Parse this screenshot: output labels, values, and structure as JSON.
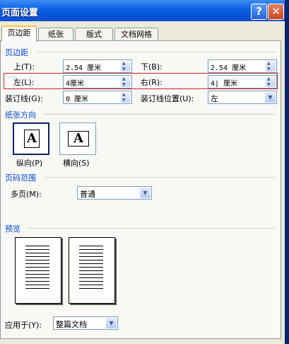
{
  "window": {
    "title": "页面设置",
    "help": "?",
    "close": "✕"
  },
  "tabs": [
    "页边距",
    "纸张",
    "版式",
    "文档网格"
  ],
  "margins": {
    "section": "页边距",
    "top": {
      "label": "上(T):",
      "value": "2.54 厘米"
    },
    "bottom": {
      "label": "下(B):",
      "value": "2.54 厘米"
    },
    "left": {
      "label": "左(L):",
      "value": "4厘米"
    },
    "right": {
      "label": "右(R):",
      "value": "4| 厘米"
    },
    "gutter": {
      "label": "装订线(G):",
      "value": "0 厘米"
    },
    "gutter_pos": {
      "label": "装订线位置(U):",
      "value": "左"
    }
  },
  "orientation": {
    "section": "纸张方向",
    "portrait": {
      "label": "纵向(P)",
      "glyph": "A"
    },
    "landscape": {
      "label": "横向(S)",
      "glyph": "A"
    }
  },
  "pages": {
    "section": "页码范围",
    "label": "多页(M):",
    "value": "普通"
  },
  "preview": {
    "section": "预览"
  },
  "apply": {
    "label": "应用于(Y):",
    "value": "整篇文档"
  }
}
